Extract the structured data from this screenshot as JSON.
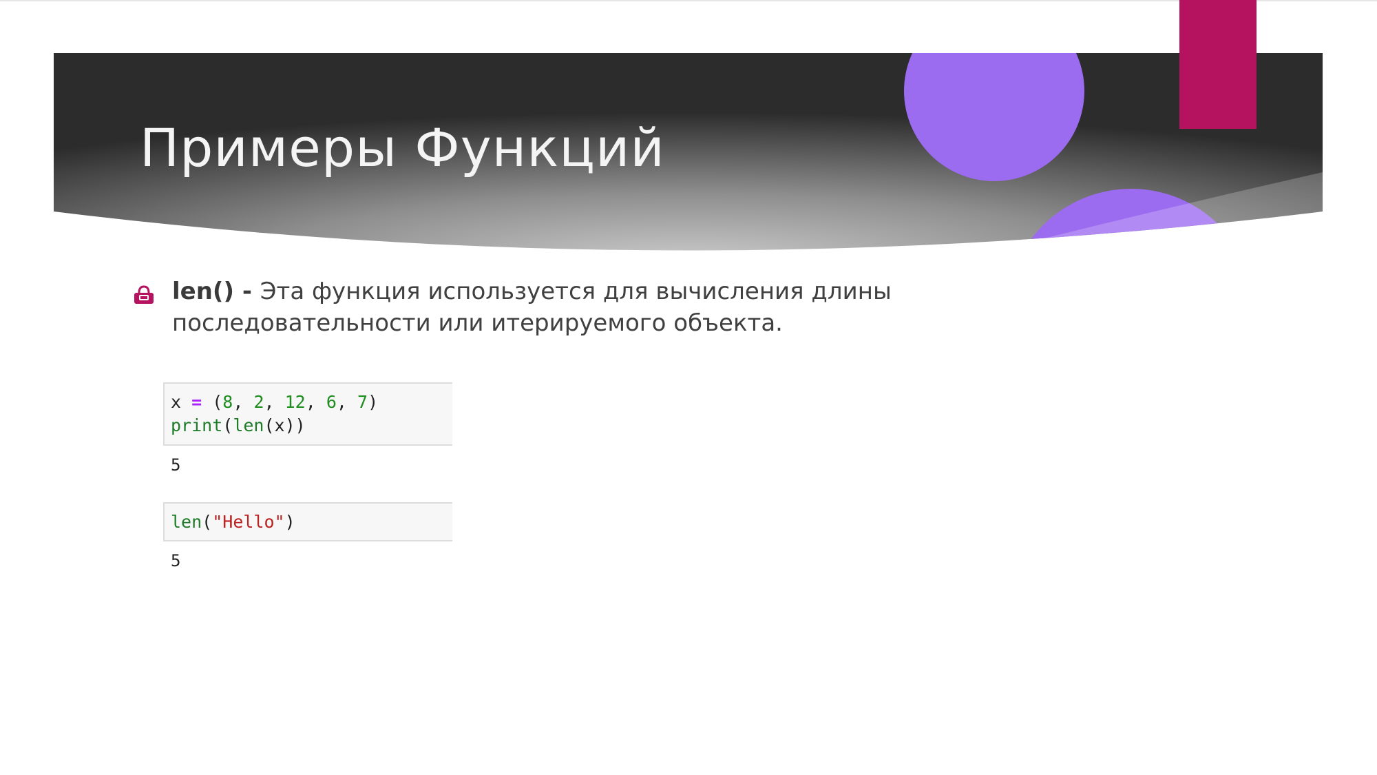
{
  "slide": {
    "title": "Примеры Функций",
    "colors": {
      "header_dark": "#2f2f2f",
      "header_light": "#bdbdbd",
      "accent_purple": "#9b6bf0",
      "accent_magenta": "#b5135f"
    }
  },
  "bullet": {
    "icon": "bullet-bag-icon",
    "term": "len() - ",
    "text": "Эта функция используется для вычисления длины последовательности или итерируемого объекта."
  },
  "examples": [
    {
      "code_lines": [
        [
          {
            "t": "x ",
            "c": "plain"
          },
          {
            "t": "=",
            "c": "op"
          },
          {
            "t": " (",
            "c": "plain"
          },
          {
            "t": "8",
            "c": "num"
          },
          {
            "t": ", ",
            "c": "plain"
          },
          {
            "t": "2",
            "c": "num"
          },
          {
            "t": ", ",
            "c": "plain"
          },
          {
            "t": "12",
            "c": "num"
          },
          {
            "t": ", ",
            "c": "plain"
          },
          {
            "t": "6",
            "c": "num"
          },
          {
            "t": ", ",
            "c": "plain"
          },
          {
            "t": "7",
            "c": "num"
          },
          {
            "t": ")",
            "c": "plain"
          }
        ],
        [
          {
            "t": "print",
            "c": "kw"
          },
          {
            "t": "(",
            "c": "plain"
          },
          {
            "t": "len",
            "c": "kw"
          },
          {
            "t": "(x))",
            "c": "plain"
          }
        ]
      ],
      "output": "5"
    },
    {
      "code_lines": [
        [
          {
            "t": "len",
            "c": "kw"
          },
          {
            "t": "(",
            "c": "plain"
          },
          {
            "t": "\"Hello\"",
            "c": "str"
          },
          {
            "t": ")",
            "c": "plain"
          }
        ]
      ],
      "output": "5"
    }
  ]
}
